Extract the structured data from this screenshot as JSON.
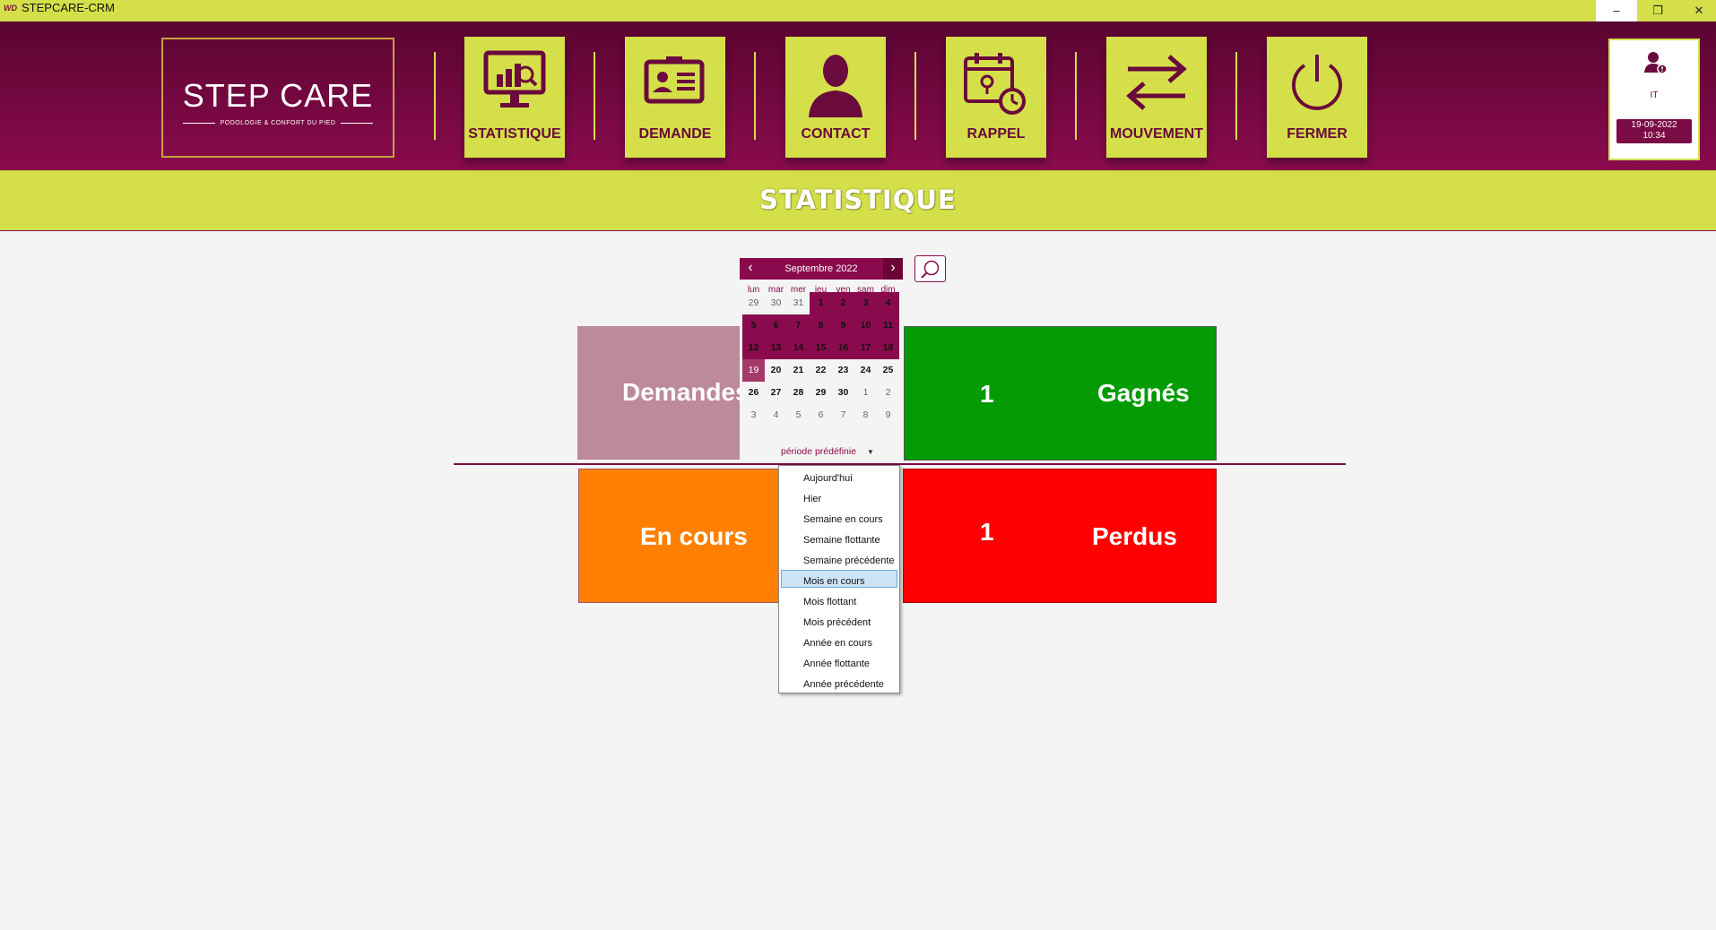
{
  "window": {
    "title": "STEPCARE-CRM",
    "icon_text": "WD",
    "minimize": "–",
    "maximize": "❐",
    "close": "✕"
  },
  "logo": {
    "main": "STEP CARE",
    "sub": "PODOLOGIE & CONFORT DU PIED"
  },
  "nav": {
    "statistique": "STATISTIQUE",
    "demande": "DEMANDE",
    "contact": "CONTACT",
    "rappel": "RAPPEL",
    "mouvement": "MOUVEMENT",
    "fermer": "FERMER"
  },
  "user": {
    "name": "IT",
    "date": "19-09-2022",
    "time": "10:34"
  },
  "section": {
    "title": "STATISTIQUE"
  },
  "tiles": {
    "demandes": {
      "label": "Demandes"
    },
    "gagnes": {
      "count": "1",
      "label": "Gagnés"
    },
    "en_cours": {
      "label": "En cours"
    },
    "perdus": {
      "count": "1",
      "label": "Perdus"
    }
  },
  "calendar": {
    "month_label": "Septembre 2022",
    "weekdays": [
      "lun",
      "mar",
      "mer",
      "jeu",
      "ven",
      "sam",
      "dim"
    ],
    "weeks": [
      [
        "29",
        "30",
        "31",
        "1",
        "2",
        "3",
        "4"
      ],
      [
        "5",
        "6",
        "7",
        "8",
        "9",
        "10",
        "11"
      ],
      [
        "12",
        "13",
        "14",
        "15",
        "16",
        "17",
        "18"
      ],
      [
        "19",
        "20",
        "21",
        "22",
        "23",
        "24",
        "25"
      ],
      [
        "26",
        "27",
        "28",
        "29",
        "30",
        "1",
        "2"
      ],
      [
        "3",
        "4",
        "5",
        "6",
        "7",
        "8",
        "9"
      ]
    ],
    "period_label": "période prédéfinie",
    "selected_range": "1–19 Septembre 2022",
    "today": "19"
  },
  "dropdown": {
    "items": [
      "Aujourd'hui",
      "Hier",
      "Semaine en cours",
      "Semaine flottante",
      "Semaine précédente",
      "Mois en cours",
      "Mois flottant",
      "Mois précédent",
      "Année en cours",
      "Année flottante",
      "Année précédente"
    ],
    "highlighted": "Mois en cours"
  },
  "colors": {
    "brand_dark": "#6b0a3c",
    "brand_accent": "#d4df4a",
    "tile_demandes": "#bc8a9c",
    "tile_gagnes": "#049b04",
    "tile_en_cours": "#ff8000",
    "tile_perdus": "#ff0000"
  }
}
